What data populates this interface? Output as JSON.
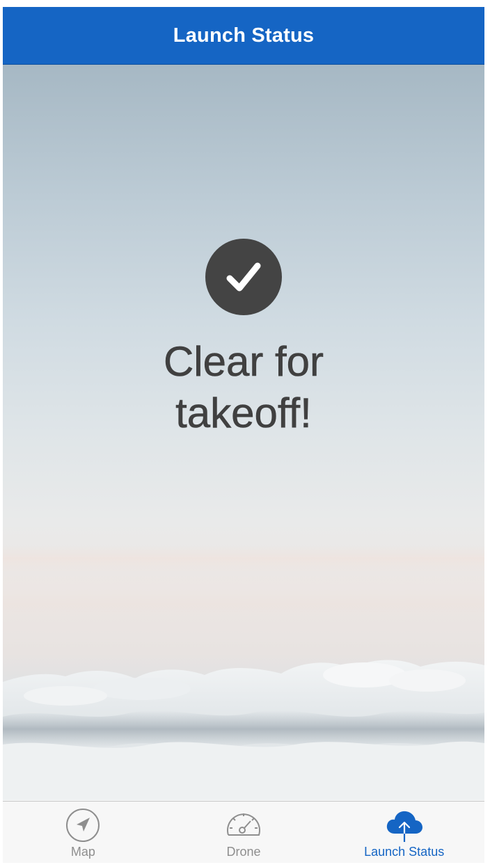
{
  "navbar": {
    "title": "Launch Status"
  },
  "status": {
    "icon": "checkmark-circle-icon",
    "line1": "Clear for",
    "line2": "takeoff!",
    "badge_color": "#444444",
    "text_color": "#404040"
  },
  "tabbar": {
    "active_color": "#1565c4",
    "inactive_color": "#8e8e8e",
    "tabs": [
      {
        "label": "Map",
        "icon": "location-arrow-icon",
        "active": false
      },
      {
        "label": "Drone",
        "icon": "speedometer-icon",
        "active": false
      },
      {
        "label": "Launch Status",
        "icon": "cloud-upload-icon",
        "active": true
      }
    ]
  },
  "theme": {
    "brand_blue": "#1565c4"
  }
}
